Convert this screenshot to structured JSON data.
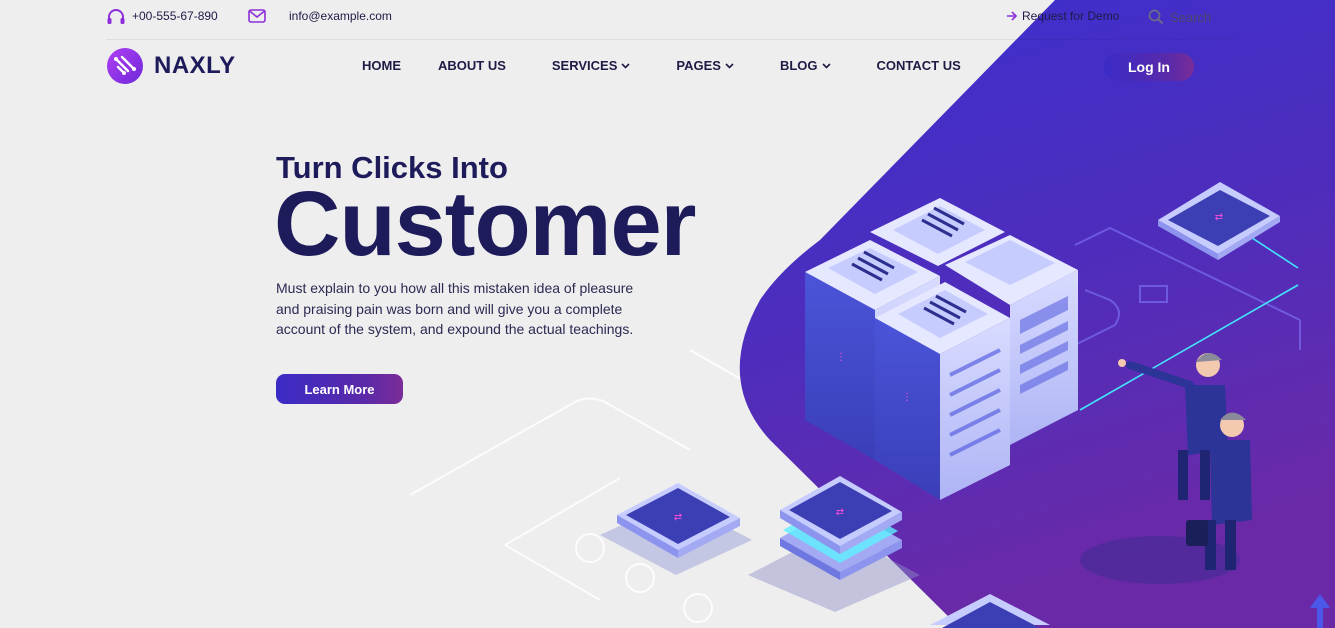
{
  "topbar": {
    "phone": "+00-555-67-890",
    "email": "info@example.com",
    "request_demo": "Request for Demo",
    "search_placeholder": "Search"
  },
  "header": {
    "brand": "NAXLY",
    "nav": [
      "HOME",
      "ABOUT US",
      "SERVICES",
      "PAGES",
      "BLOG",
      "CONTACT US"
    ],
    "login": "Log In"
  },
  "hero": {
    "subtitle": "Turn Clicks Into",
    "title": "Customer",
    "description": "Must explain to you how all this mistaken idea of pleasure and praising pain was born and will give you a complete account of the system, and expound the actual teachings.",
    "cta": "Learn More"
  },
  "colors": {
    "navy": "#1e1b5a",
    "accent_start": "#3a2bc6",
    "accent_end": "#7b2c98",
    "bg": "#eeeeef"
  },
  "icons": [
    "headset-icon",
    "mail-icon",
    "arrow-right-icon",
    "search-icon",
    "chevron-down-icon",
    "arrow-up-icon"
  ]
}
